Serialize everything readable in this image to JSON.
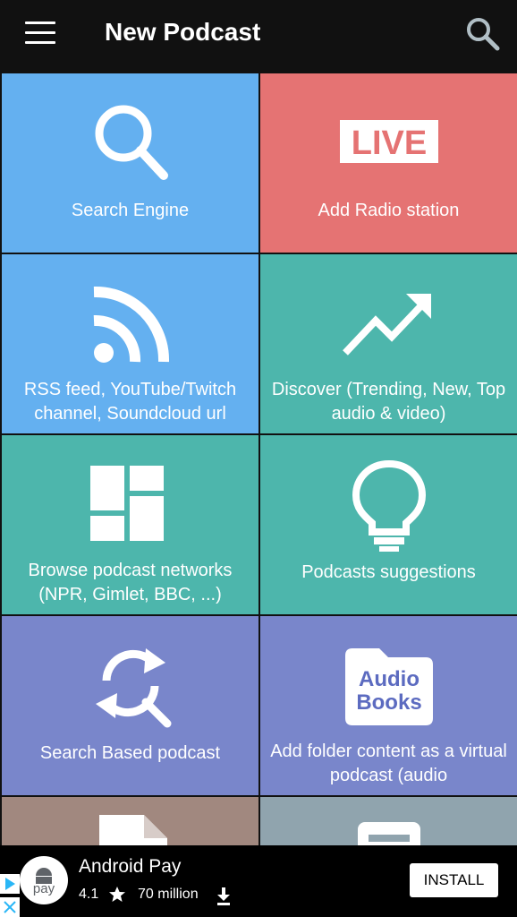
{
  "app": {
    "title": "New Podcast",
    "menu_icon": "hamburger-menu-icon",
    "search_icon": "search-icon"
  },
  "tiles": [
    {
      "label": "Search Engine",
      "color": "#64B0F0",
      "icon": "search-icon"
    },
    {
      "label": "Add Radio station",
      "color": "#E57373",
      "icon": "live-icon",
      "icon_text": "LIVE"
    },
    {
      "label": "RSS feed, YouTube/Twitch channel, Soundcloud url",
      "color": "#64B0F0",
      "icon": "rss-icon"
    },
    {
      "label": "Discover (Trending, New, Top audio & video)",
      "color": "#4DB6AC",
      "icon": "trending-icon"
    },
    {
      "label": "Browse podcast networks (NPR, Gimlet, BBC, ...)",
      "color": "#4DB6AC",
      "icon": "dashboard-icon"
    },
    {
      "label": "Podcasts suggestions",
      "color": "#4DB6AC",
      "icon": "lightbulb-icon"
    },
    {
      "label": "Search Based podcast",
      "color": "#7986CB",
      "icon": "search-refresh-icon"
    },
    {
      "label": "Add folder content as a virtual podcast (audio",
      "color": "#7986CB",
      "icon": "audiobooks-folder-icon",
      "icon_text": "Audio Books"
    },
    {
      "label": "",
      "color": "#A1887F",
      "icon": "document-icon"
    },
    {
      "label": "",
      "color": "#90A4AE",
      "icon": "card-icon"
    }
  ],
  "ad": {
    "title": "Android Pay",
    "rating": "4.1",
    "downloads": "70 million",
    "install_label": "INSTALL",
    "logo_text": "pay",
    "logo_icon": "android-pay-logo-icon",
    "star_icon": "star-icon",
    "download_icon": "download-icon",
    "adchoices_icon": "adchoices-icon",
    "close_icon": "close-icon"
  }
}
